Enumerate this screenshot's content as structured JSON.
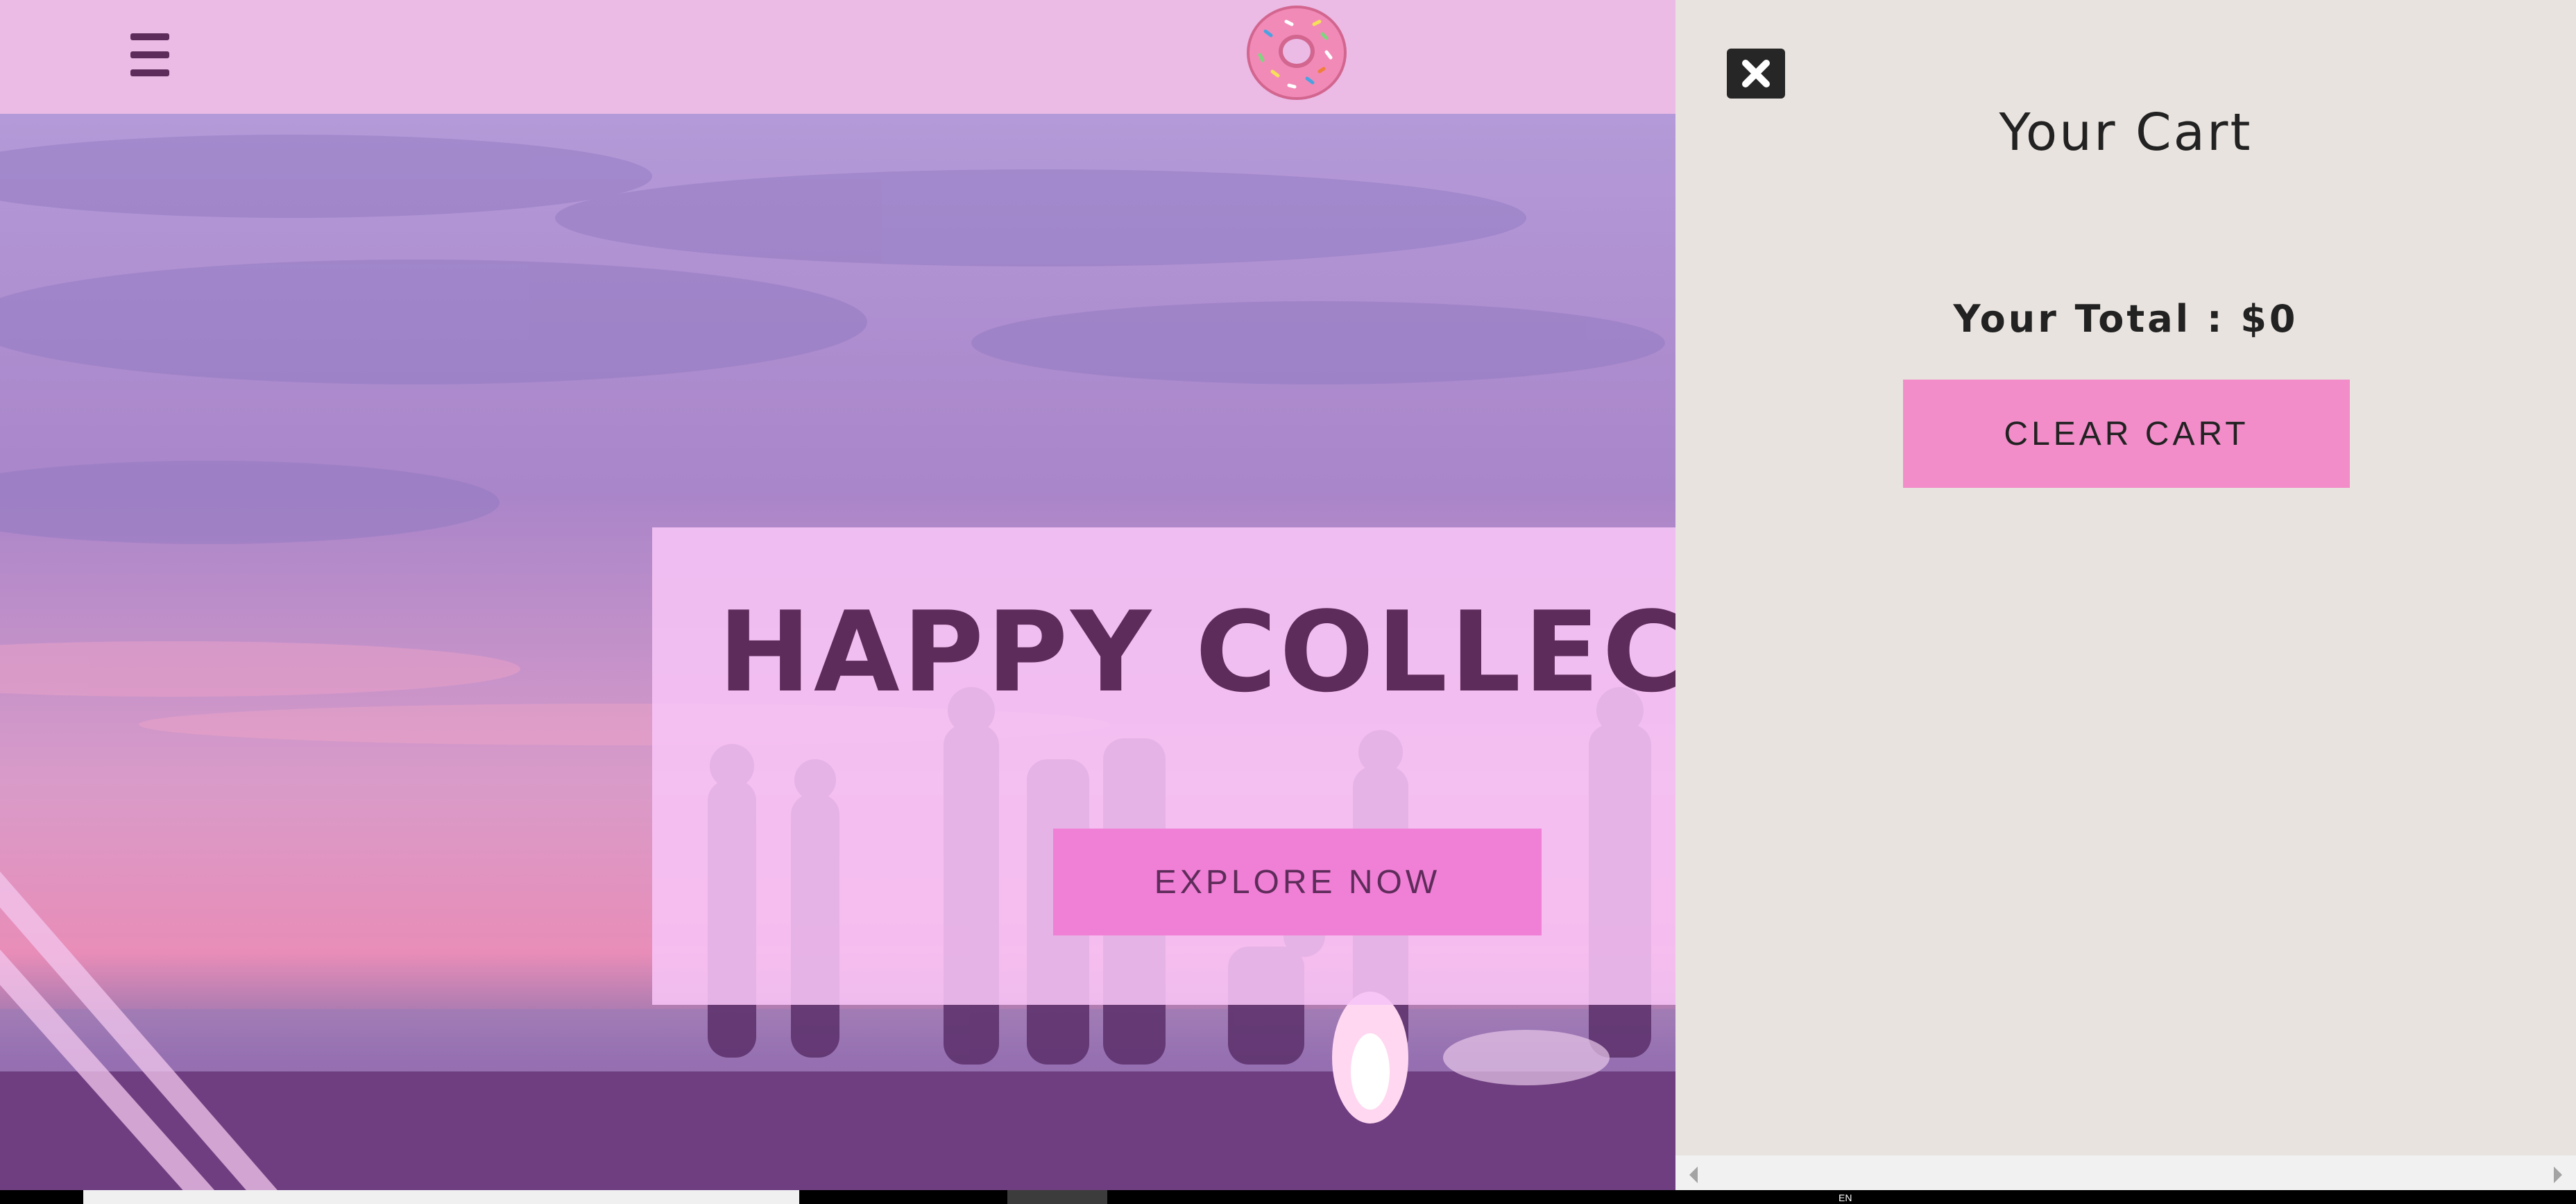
{
  "navbar": {
    "menu_icon": "hamburger-menu-icon",
    "logo": "pink-donut-logo",
    "background": "#ebbae5"
  },
  "hero": {
    "title": "HAPPY COLLECTI",
    "button_label": "EXPLORE NOW",
    "image": "beach-bonfire-sunset-photo"
  },
  "cart": {
    "close_icon": "close-x-icon",
    "title": "Your Cart",
    "total_label": "Your Total : $0",
    "clear_label": "CLEAR CART",
    "background": "#e8e3df"
  },
  "bottom_strip": {
    "text": "EN"
  },
  "colors": {
    "accent_pink": "#f07fd6",
    "clear_button": "#f28dc9",
    "text_purple": "#5e2c5a",
    "banner": "#f7c4f6"
  }
}
